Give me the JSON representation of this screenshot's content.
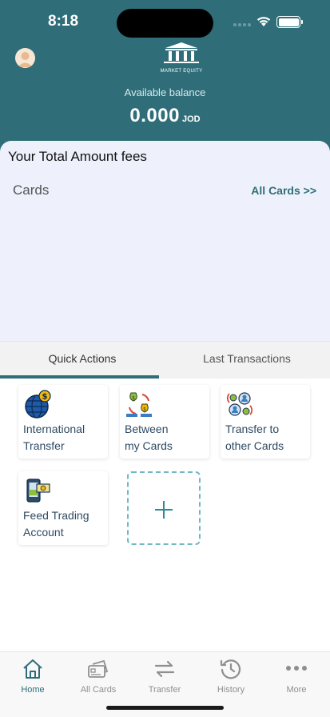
{
  "status": {
    "time": "8:18"
  },
  "header": {
    "logo_text": "MARKET EQUITY",
    "balance_label": "Available balance",
    "balance_amount": "0.000",
    "balance_currency": "JOD"
  },
  "sheet": {
    "fees_title": "Your Total Amount fees",
    "cards_title": "Cards",
    "all_cards_link": "All Cards >>"
  },
  "tabs": [
    {
      "label": "Quick Actions",
      "active": true
    },
    {
      "label": "Last Transactions",
      "active": false
    }
  ],
  "actions": [
    {
      "line1": "International",
      "line2": "Transfer",
      "icon": "globe-transfer-icon"
    },
    {
      "line1": "Between",
      "line2": "my Cards",
      "icon": "money-exchange-icon"
    },
    {
      "line1": "Transfer to",
      "line2": "other Cards",
      "icon": "people-exchange-icon"
    },
    {
      "line1": "Feed Trading",
      "line2": "Account",
      "icon": "phone-money-icon"
    }
  ],
  "nav": [
    {
      "label": "Home",
      "icon": "home-icon",
      "active": true
    },
    {
      "label": "All Cards",
      "icon": "cards-icon",
      "active": false
    },
    {
      "label": "Transfer",
      "icon": "transfer-arrows-icon",
      "active": false
    },
    {
      "label": "History",
      "icon": "history-icon",
      "active": false
    },
    {
      "label": "More",
      "icon": "more-dots-icon",
      "active": false
    }
  ],
  "colors": {
    "primary": "#2f6e79",
    "sheet": "#eef1fb",
    "accent_gold": "#f2b705"
  }
}
